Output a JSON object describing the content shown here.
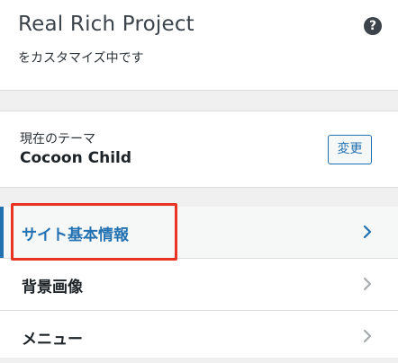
{
  "header": {
    "title": "Real Rich Project",
    "subtitle": "をカスタマイズ中です",
    "help_glyph": "?"
  },
  "theme": {
    "label": "現在のテーマ",
    "name": "Cocoon Child",
    "change_button": "変更"
  },
  "sections": [
    {
      "label": "サイト基本情報",
      "active": true
    },
    {
      "label": "背景画像",
      "active": false
    },
    {
      "label": "メニュー",
      "active": false
    }
  ],
  "colors": {
    "accent": "#2271b1",
    "highlight": "#ea3323",
    "text": "#1d2327",
    "background": "#f0f0f1"
  }
}
